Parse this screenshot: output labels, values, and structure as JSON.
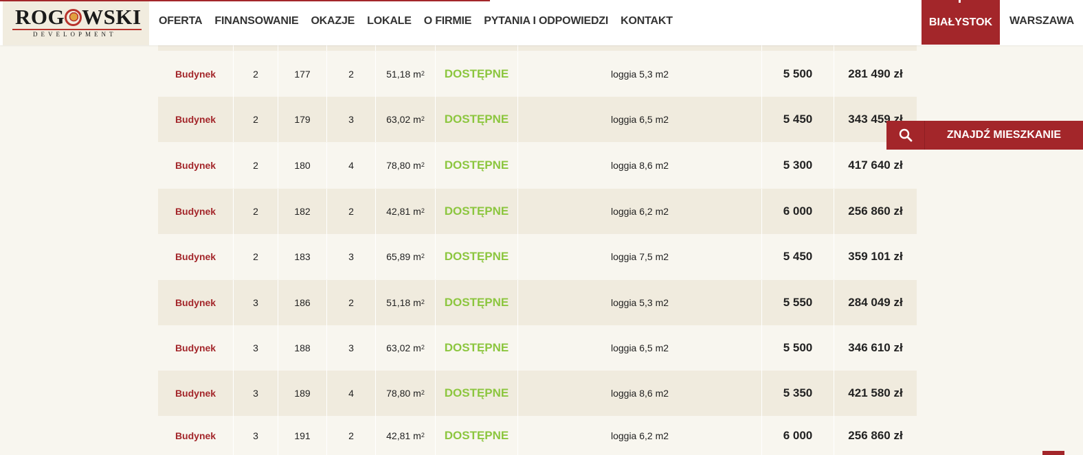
{
  "brand": {
    "logo_name": "ROGOWSKI",
    "logo_sub": "DEVELOPMENT"
  },
  "nav": [
    "OFERTA",
    "FINANSOWANIE",
    "OKAZJE",
    "LOKALE",
    "O FIRMIE",
    "PYTANIA I ODPOWIEDZI",
    "KONTAKT"
  ],
  "cities": {
    "active": "BIAŁYSTOK",
    "other": "WARSZAWA"
  },
  "finder": {
    "label": "ZNAJDŹ MIESZKANIE",
    "icon": "search-icon"
  },
  "area_unit": "m",
  "area_unit_sup": "2",
  "rows": [
    {
      "type": "Budynek",
      "floor": "2",
      "number": "177",
      "rooms": "2",
      "area": "51,18",
      "status": "DOSTĘPNE",
      "extra": "loggia 5,3 m2",
      "price_per_m2": "5 500",
      "price": "281 490 zł"
    },
    {
      "type": "Budynek",
      "floor": "2",
      "number": "179",
      "rooms": "3",
      "area": "63,02",
      "status": "DOSTĘPNE",
      "extra": "loggia 6,5 m2",
      "price_per_m2": "5 450",
      "price": "343 459 zł"
    },
    {
      "type": "Budynek",
      "floor": "2",
      "number": "180",
      "rooms": "4",
      "area": "78,80",
      "status": "DOSTĘPNE",
      "extra": "loggia 8,6 m2",
      "price_per_m2": "5 300",
      "price": "417 640 zł"
    },
    {
      "type": "Budynek",
      "floor": "2",
      "number": "182",
      "rooms": "2",
      "area": "42,81",
      "status": "DOSTĘPNE",
      "extra": "loggia 6,2 m2",
      "price_per_m2": "6 000",
      "price": "256 860 zł"
    },
    {
      "type": "Budynek",
      "floor": "2",
      "number": "183",
      "rooms": "3",
      "area": "65,89",
      "status": "DOSTĘPNE",
      "extra": "loggia 7,5 m2",
      "price_per_m2": "5 450",
      "price": "359 101 zł"
    },
    {
      "type": "Budynek",
      "floor": "3",
      "number": "186",
      "rooms": "2",
      "area": "51,18",
      "status": "DOSTĘPNE",
      "extra": "loggia 5,3 m2",
      "price_per_m2": "5 550",
      "price": "284 049 zł"
    },
    {
      "type": "Budynek",
      "floor": "3",
      "number": "188",
      "rooms": "3",
      "area": "63,02",
      "status": "DOSTĘPNE",
      "extra": "loggia 6,5 m2",
      "price_per_m2": "5 500",
      "price": "346 610 zł"
    },
    {
      "type": "Budynek",
      "floor": "3",
      "number": "189",
      "rooms": "4",
      "area": "78,80",
      "status": "DOSTĘPNE",
      "extra": "loggia 8,6 m2",
      "price_per_m2": "5 350",
      "price": "421 580 zł"
    },
    {
      "type": "Budynek",
      "floor": "3",
      "number": "191",
      "rooms": "2",
      "area": "42,81",
      "status": "DOSTĘPNE",
      "extra": "loggia 6,2 m2",
      "price_per_m2": "6 000",
      "price": "256 860 zł"
    }
  ],
  "colors": {
    "brand_red": "#a3262a",
    "status_green": "#8cc63f",
    "row_stripe": "#f0ebde",
    "page_bg": "#f8f6ef"
  }
}
